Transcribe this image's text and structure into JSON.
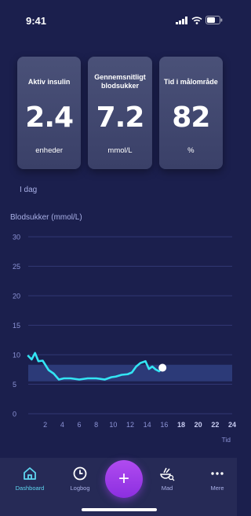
{
  "status": {
    "time": "9:41"
  },
  "cards": [
    {
      "label": "Aktiv insulin",
      "value": "2.4",
      "unit": "enheder"
    },
    {
      "label": "Gennemsnitligt blodsukker",
      "value": "7.2",
      "unit": "mmol/L"
    },
    {
      "label": "Tid i målområde",
      "value": "82",
      "unit": "%"
    }
  ],
  "today_label": "I dag",
  "chart_title": "Blodsukker (mmol/L)",
  "chart_data": {
    "type": "line",
    "title": "Blodsukker (mmol/L)",
    "xlabel": "Tid",
    "ylabel": "",
    "xlim": [
      0,
      24
    ],
    "ylim": [
      0,
      30
    ],
    "yticks": [
      0,
      5,
      10,
      15,
      20,
      25,
      30
    ],
    "xticks": [
      2,
      4,
      6,
      8,
      10,
      12,
      14,
      16,
      18,
      20,
      22,
      24
    ],
    "target_range": [
      5.5,
      8.3
    ],
    "grid": true,
    "series": [
      {
        "color": "#33e4f3",
        "x": [
          0,
          0.4,
          0.8,
          1.2,
          1.7,
          2.4,
          3.0,
          3.6,
          4.2,
          5.0,
          6.0,
          7.0,
          8.0,
          9.0,
          9.8,
          10.3,
          11.0,
          11.7,
          12.2,
          12.7,
          13.2,
          13.8,
          14.2,
          14.6,
          15.0,
          15.4,
          15.8
        ],
        "y": [
          9.8,
          9.2,
          10.3,
          8.9,
          9.0,
          7.4,
          6.8,
          5.8,
          6.0,
          6.0,
          5.8,
          6.0,
          6.0,
          5.8,
          6.2,
          6.3,
          6.6,
          6.7,
          7.0,
          8.0,
          8.6,
          8.9,
          7.6,
          8.0,
          7.5,
          7.2,
          7.8
        ]
      }
    ],
    "current_point": {
      "x": 15.8,
      "y": 7.8
    }
  },
  "nav": [
    {
      "label": "Dashboard",
      "icon": "home-icon"
    },
    {
      "label": "Logbog",
      "icon": "clock-icon"
    },
    {
      "label": "+",
      "icon": "plus-icon"
    },
    {
      "label": "Mad",
      "icon": "food-icon"
    },
    {
      "label": "Mere",
      "icon": "more-icon"
    }
  ],
  "colors": {
    "background": "#1b1f4d",
    "accent": "#33e4f3",
    "fab": "#a040f0",
    "active_nav": "#5fd6f0"
  }
}
